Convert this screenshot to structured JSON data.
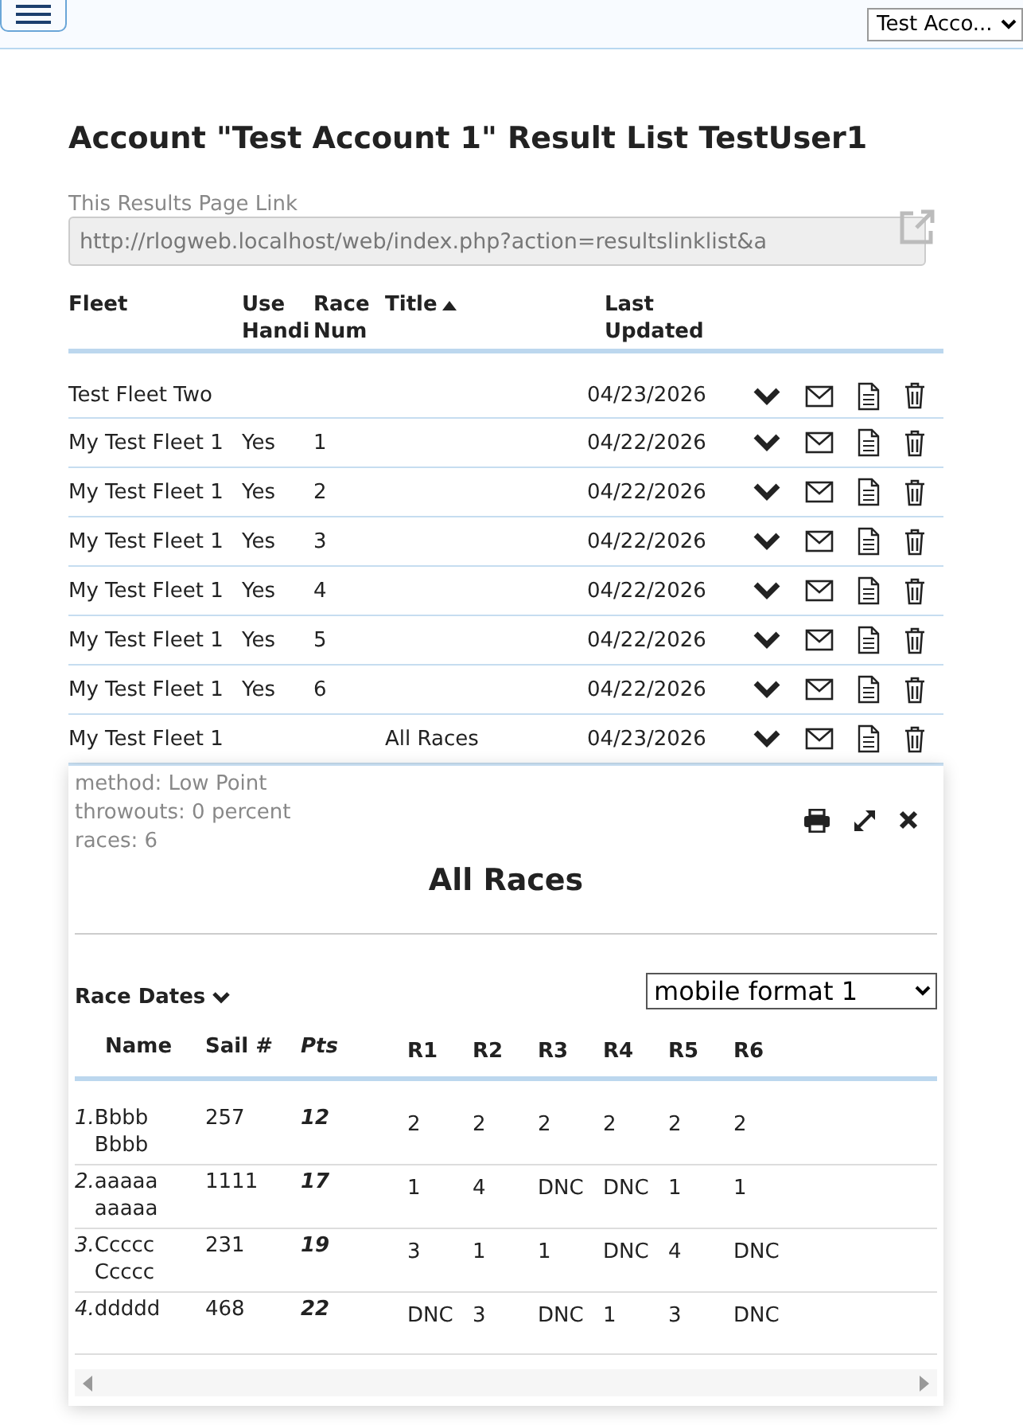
{
  "header": {
    "account_select": "Test Acco..."
  },
  "page_title": "Account \"Test Account 1\" Result List TestUser1",
  "link": {
    "label": "This Results Page Link",
    "value": "http://rlogweb.localhost/web/index.php?action=resultslinklist&a"
  },
  "table": {
    "columns": [
      {
        "label": "Fleet",
        "sorted": false
      },
      {
        "label": "Use Handi",
        "sorted": false
      },
      {
        "label": "Race Num",
        "sorted": false
      },
      {
        "label": "Title",
        "sorted": true
      },
      {
        "label": "Last Updated",
        "sorted": false
      }
    ],
    "rows": [
      {
        "fleet": "Test Fleet Two",
        "use_handicap": "",
        "race_num": "",
        "title": "",
        "last_updated": "04/23/2026",
        "expanded": false
      },
      {
        "fleet": "My Test Fleet 1",
        "use_handicap": "Yes",
        "race_num": "1",
        "title": "",
        "last_updated": "04/22/2026",
        "expanded": false
      },
      {
        "fleet": "My Test Fleet 1",
        "use_handicap": "Yes",
        "race_num": "2",
        "title": "",
        "last_updated": "04/22/2026",
        "expanded": false
      },
      {
        "fleet": "My Test Fleet 1",
        "use_handicap": "Yes",
        "race_num": "3",
        "title": "",
        "last_updated": "04/22/2026",
        "expanded": false
      },
      {
        "fleet": "My Test Fleet 1",
        "use_handicap": "Yes",
        "race_num": "4",
        "title": "",
        "last_updated": "04/22/2026",
        "expanded": false
      },
      {
        "fleet": "My Test Fleet 1",
        "use_handicap": "Yes",
        "race_num": "5",
        "title": "",
        "last_updated": "04/22/2026",
        "expanded": false
      },
      {
        "fleet": "My Test Fleet 1",
        "use_handicap": "Yes",
        "race_num": "6",
        "title": "",
        "last_updated": "04/22/2026",
        "expanded": false
      },
      {
        "fleet": "My Test Fleet 1",
        "use_handicap": "",
        "race_num": "",
        "title": "All Races",
        "last_updated": "04/23/2026",
        "expanded": true
      }
    ]
  },
  "result_panel": {
    "info": [
      "method: Low Point",
      "throwouts: 0 percent",
      "races: 6"
    ],
    "title": "All Races",
    "race_dates_label": "Race Dates",
    "format_select": "mobile format 1",
    "columns": [
      "Name",
      "Sail #",
      "Pts",
      "R1",
      "R2",
      "R3",
      "R4",
      "R5",
      "R6"
    ],
    "rows": [
      {
        "rank": "1.",
        "name": "Bbbb Bbbb",
        "sail": "257",
        "points": "12",
        "races": [
          "2",
          "2",
          "2",
          "2",
          "2",
          "2"
        ]
      },
      {
        "rank": "2.",
        "name": "aaaaa aaaaa",
        "sail": "1111",
        "points": "17",
        "races": [
          "1",
          "4",
          "DNC",
          "DNC",
          "1",
          "1"
        ]
      },
      {
        "rank": "3.",
        "name": "Ccccc Ccccc",
        "sail": "231",
        "points": "19",
        "races": [
          "3",
          "1",
          "1",
          "DNC",
          "4",
          "DNC"
        ]
      },
      {
        "rank": "4.",
        "name": "ddddd",
        "sail": "468",
        "points": "22",
        "races": [
          "DNC",
          "3",
          "DNC",
          "1",
          "3",
          "DNC"
        ]
      }
    ]
  }
}
